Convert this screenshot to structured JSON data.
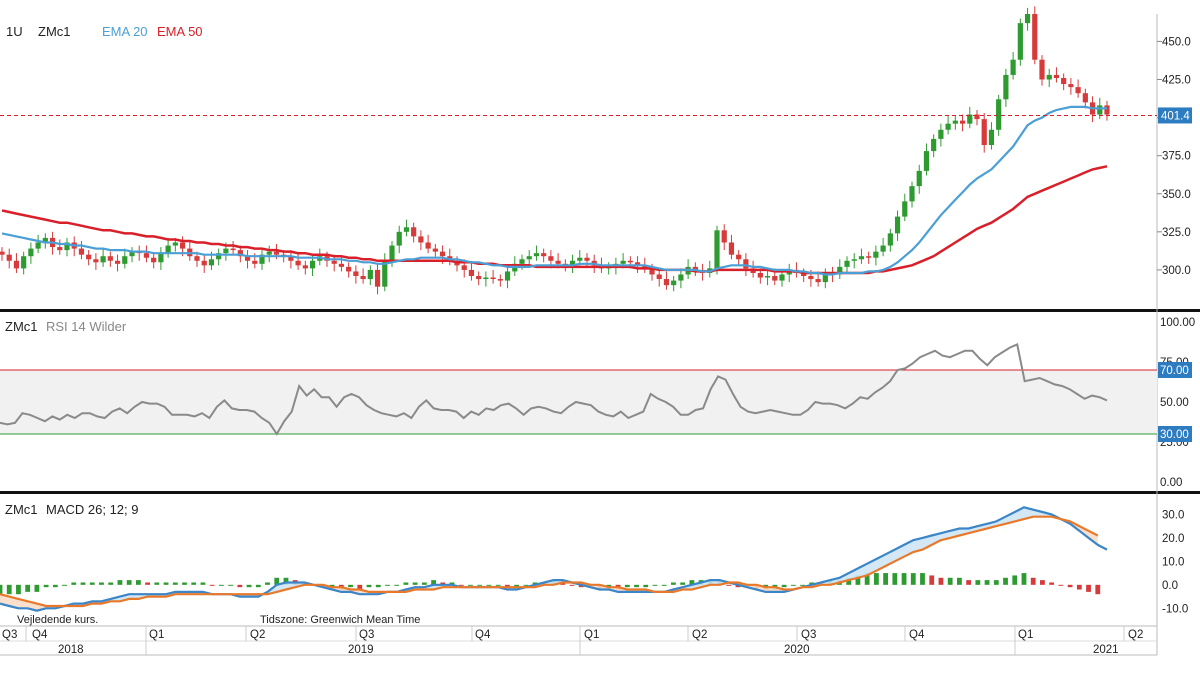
{
  "header": {
    "interval": "1U",
    "symbol": "ZMc1",
    "ema20_label": "EMA 20",
    "ema50_label": "EMA 50",
    "ema20_color": "#4a9fd6",
    "ema50_color": "#d9202a"
  },
  "rsi_panel": {
    "symbol": "ZMc1",
    "title": "RSI 14 Wilder",
    "upper_badge": "70.00",
    "lower_badge": "30.00",
    "y_ticks": [
      "100.00",
      "75.00",
      "50.00",
      "25.00",
      "0.00"
    ]
  },
  "macd_panel": {
    "symbol": "ZMc1",
    "title": "MACD 26; 12; 9",
    "y_ticks": [
      "30.0",
      "20.0",
      "10.0",
      "0.0",
      "-10.0"
    ]
  },
  "footer": {
    "note_left": "Vejledende kurs.",
    "note_timezone": "Tidszone: Greenwich Mean Time",
    "quarters": [
      "Q3",
      "Q4",
      "Q1",
      "Q2",
      "Q3",
      "Q4",
      "Q1",
      "Q2",
      "Q3",
      "Q4",
      "Q1",
      "Q2"
    ],
    "years": [
      "2018",
      "2019",
      "2020",
      "2021"
    ]
  },
  "chart_data": [
    {
      "type": "candlestick",
      "title": "ZMc1",
      "series": [
        {
          "name": "EMA 20",
          "color": "#4a9fd6"
        },
        {
          "name": "EMA 50",
          "color": "#d9202a"
        }
      ],
      "y_ticks": [
        300,
        325,
        350,
        375,
        400,
        425,
        450
      ],
      "ylim": [
        275,
        468
      ],
      "last_price": 401.4,
      "last_price_label": "401.4",
      "x_period": [
        "2018 Q3",
        "2021 Q1"
      ],
      "ohlc_weekly_approx": {
        "close": [
          310,
          306,
          301,
          309,
          314,
          318,
          321,
          315,
          313,
          318,
          314,
          310,
          307,
          305,
          309,
          306,
          304,
          309,
          312,
          311,
          308,
          305,
          311,
          316,
          318,
          314,
          309,
          306,
          303,
          307,
          311,
          314,
          313,
          309,
          306,
          304,
          310,
          312,
          310,
          309,
          306,
          303,
          301,
          306,
          309,
          306,
          304,
          302,
          299,
          296,
          294,
          300,
          289,
          306,
          316,
          325,
          328,
          322,
          318,
          314,
          312,
          309,
          306,
          303,
          300,
          296,
          294,
          295,
          294,
          293,
          299,
          304,
          307,
          309,
          311,
          309,
          306,
          304,
          303,
          306,
          308,
          306,
          303,
          301,
          302,
          304,
          306,
          305,
          303,
          301,
          297,
          294,
          290,
          293,
          297,
          302,
          300,
          298,
          301,
          326,
          318,
          310,
          307,
          301,
          298,
          295,
          296,
          293,
          297,
          300,
          298,
          296,
          294,
          292,
          298,
          297,
          302,
          306,
          307,
          309,
          308,
          312,
          316,
          324,
          335,
          345,
          355,
          365,
          378,
          386,
          392,
          396,
          398,
          396,
          402,
          399,
          382,
          392,
          412,
          428,
          438,
          462,
          468,
          438,
          425,
          428,
          426,
          422,
          420,
          416,
          410,
          402,
          408,
          402
        ],
        "ema20": [
          324,
          323,
          322,
          321,
          320,
          319,
          318,
          318,
          317,
          317,
          316,
          316,
          315,
          314,
          314,
          313,
          313,
          313,
          312,
          312,
          312,
          311,
          311,
          311,
          311,
          311,
          311,
          311,
          310,
          310,
          310,
          310,
          310,
          310,
          309,
          309,
          309,
          309,
          309,
          309,
          309,
          308,
          308,
          308,
          308,
          307,
          307,
          307,
          306,
          306,
          305,
          305,
          304,
          304,
          305,
          306,
          307,
          307,
          308,
          308,
          308,
          308,
          307,
          307,
          306,
          305,
          305,
          304,
          303,
          303,
          302,
          302,
          302,
          302,
          303,
          303,
          303,
          303,
          303,
          303,
          304,
          304,
          304,
          303,
          303,
          303,
          303,
          303,
          303,
          303,
          302,
          301,
          300,
          300,
          300,
          300,
          300,
          299,
          299,
          301,
          302,
          303,
          303,
          303,
          302,
          302,
          301,
          300,
          300,
          300,
          299,
          299,
          298,
          298,
          297,
          297,
          298,
          298,
          298,
          298,
          299,
          299,
          300,
          302,
          305,
          309,
          313,
          318,
          324,
          330,
          336,
          341,
          346,
          351,
          356,
          360,
          363,
          366,
          371,
          376,
          381,
          388,
          395,
          398,
          400,
          403,
          405,
          406,
          407,
          407,
          407,
          406,
          406,
          406
        ],
        "ema50": [
          339,
          338,
          337,
          336,
          335,
          334,
          333,
          332,
          331,
          331,
          330,
          329,
          328,
          327,
          326,
          326,
          325,
          324,
          324,
          323,
          322,
          322,
          321,
          320,
          320,
          319,
          319,
          318,
          318,
          317,
          317,
          316,
          316,
          315,
          315,
          314,
          314,
          313,
          313,
          312,
          312,
          311,
          311,
          310,
          310,
          310,
          309,
          309,
          308,
          308,
          307,
          307,
          306,
          306,
          306,
          306,
          306,
          306,
          306,
          306,
          306,
          306,
          306,
          305,
          305,
          305,
          304,
          304,
          304,
          303,
          303,
          303,
          303,
          303,
          302,
          302,
          302,
          302,
          302,
          302,
          302,
          302,
          302,
          302,
          302,
          302,
          302,
          302,
          301,
          301,
          301,
          300,
          300,
          300,
          300,
          300,
          299,
          299,
          299,
          300,
          300,
          300,
          300,
          300,
          300,
          300,
          300,
          299,
          299,
          299,
          299,
          298,
          298,
          298,
          298,
          298,
          298,
          298,
          298,
          298,
          298,
          299,
          299,
          300,
          301,
          302,
          303,
          305,
          307,
          309,
          312,
          315,
          318,
          321,
          324,
          327,
          329,
          331,
          334,
          337,
          340,
          344,
          348,
          350,
          352,
          354,
          356,
          358,
          360,
          362,
          364,
          366,
          367,
          368
        ]
      }
    },
    {
      "type": "line",
      "title": "RSI 14 Wilder",
      "ylim": [
        0,
        100
      ],
      "y_ticks": [
        0,
        25,
        50,
        75,
        100
      ],
      "overbought": 70,
      "oversold": 30,
      "values": [
        37,
        36,
        37,
        43,
        42,
        40,
        38,
        41,
        39,
        42,
        40,
        43,
        43,
        41,
        40,
        44,
        46,
        43,
        47,
        50,
        49,
        49,
        47,
        42,
        42,
        42,
        41,
        43,
        40,
        47,
        51,
        46,
        45,
        45,
        44,
        40,
        37,
        30,
        38,
        44,
        60,
        54,
        58,
        53,
        53,
        47,
        53,
        55,
        53,
        48,
        45,
        43,
        42,
        41,
        43,
        40,
        47,
        51,
        46,
        45,
        45,
        44,
        40,
        44,
        42,
        46,
        45,
        48,
        49,
        46,
        42,
        46,
        47,
        46,
        44,
        43,
        47,
        50,
        49,
        48,
        44,
        42,
        41,
        44,
        40,
        42,
        44,
        55,
        52,
        50,
        47,
        42,
        42,
        45,
        46,
        58,
        66,
        64,
        55,
        47,
        44,
        43,
        44,
        45,
        44,
        43,
        42,
        42,
        45,
        50,
        49,
        49,
        48,
        46,
        49,
        53,
        52,
        56,
        59,
        63,
        70,
        71,
        74,
        78,
        80,
        82,
        79,
        78,
        80,
        82,
        82,
        77,
        73,
        78,
        81,
        84,
        86,
        63,
        64,
        65,
        63,
        61,
        60,
        58,
        55,
        52,
        54,
        53,
        51
      ],
      "badges": [
        "70.00",
        "30.00"
      ]
    },
    {
      "type": "line",
      "title": "MACD 26; 12; 9",
      "ylim": [
        -12,
        34
      ],
      "y_ticks": [
        30,
        20,
        10,
        0,
        -10
      ],
      "series": [
        {
          "name": "MACD",
          "color": "#3a86c8"
        },
        {
          "name": "Signal",
          "color": "#e8792b"
        }
      ],
      "macd": [
        -8,
        -9,
        -10,
        -10,
        -11,
        -10,
        -10,
        -9,
        -8,
        -8,
        -7,
        -7,
        -6,
        -5,
        -4,
        -4,
        -4,
        -4,
        -4,
        -3,
        -3,
        -3,
        -3,
        -4,
        -4,
        -4,
        -5,
        -5,
        -5,
        -3,
        0,
        1,
        1,
        1,
        0,
        -1,
        -2,
        -3,
        -3,
        -4,
        -4,
        -4,
        -3,
        -3,
        -2,
        -1,
        -1,
        0,
        0,
        0,
        -1,
        -1,
        -1,
        -1,
        -1,
        -2,
        -2,
        -1,
        0,
        1,
        2,
        2,
        1,
        0,
        -1,
        -2,
        -2,
        -3,
        -3,
        -3,
        -3,
        -3,
        -3,
        -2,
        -1,
        0,
        1,
        2,
        2,
        1,
        0,
        -1,
        -2,
        -3,
        -3,
        -3,
        -2,
        -1,
        0,
        1,
        2,
        3,
        5,
        7,
        9,
        11,
        13,
        15,
        17,
        19,
        20,
        21,
        22,
        23,
        24,
        24,
        25,
        26,
        27,
        29,
        31,
        33,
        32,
        31,
        30,
        28,
        26,
        23,
        20,
        17,
        15
      ],
      "signal": [
        -4,
        -5,
        -6,
        -7,
        -8,
        -9,
        -9,
        -9,
        -9,
        -9,
        -8,
        -8,
        -7,
        -7,
        -6,
        -6,
        -5,
        -5,
        -5,
        -4,
        -4,
        -4,
        -4,
        -4,
        -4,
        -4,
        -4,
        -4,
        -4,
        -4,
        -3,
        -2,
        -1,
        0,
        0,
        0,
        -1,
        -1,
        -2,
        -2,
        -3,
        -3,
        -3,
        -3,
        -3,
        -2,
        -2,
        -2,
        -1,
        -1,
        -1,
        -1,
        -1,
        -1,
        -1,
        -1,
        -1,
        -1,
        -1,
        0,
        0,
        1,
        1,
        1,
        0,
        0,
        -1,
        -1,
        -2,
        -2,
        -2,
        -3,
        -3,
        -3,
        -2,
        -2,
        -1,
        0,
        0,
        1,
        1,
        0,
        0,
        -1,
        -1,
        -2,
        -2,
        -1,
        -1,
        0,
        0,
        1,
        2,
        3,
        4,
        6,
        8,
        10,
        12,
        14,
        15,
        17,
        19,
        20,
        21,
        22,
        23,
        24,
        25,
        26,
        27,
        28,
        29,
        29,
        29,
        28,
        27,
        25,
        23,
        21
      ]
    }
  ]
}
